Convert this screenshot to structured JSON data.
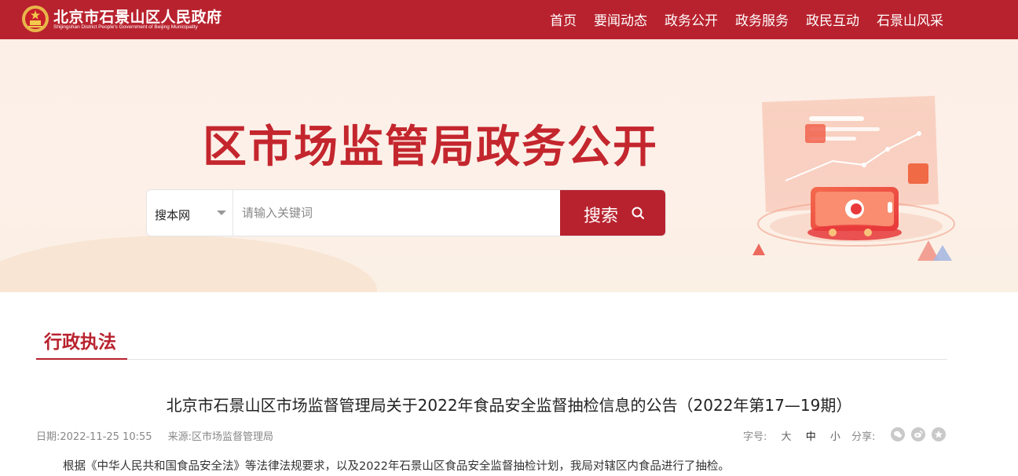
{
  "header": {
    "site_name": "北京市石景山区人民政府",
    "site_subtitle": "Shijingshan District People's Government of Beijing Municipality",
    "nav": [
      "首页",
      "要闻动态",
      "政务公开",
      "政务服务",
      "政民互动",
      "石景山风采"
    ]
  },
  "banner": {
    "title": "区市场监管局政务公开",
    "search_scope": "搜本网",
    "search_placeholder": "请输入关键词",
    "search_button": "搜索"
  },
  "section": {
    "tab": "行政执法"
  },
  "article": {
    "title": "北京市石景山区市场监督管理局关于2022年食品安全监督抽检信息的公告（2022年第17—19期）",
    "date": "日期:2022-11-25 10:55",
    "source": "来源:区市场监督管理局",
    "font_size_label": "字号:",
    "font_sizes": [
      "大",
      "中",
      "小"
    ],
    "share_label": "分享:",
    "share_icons": [
      "wechat-icon",
      "weibo-icon",
      "favorite-icon"
    ],
    "body_first_line": "根据《中华人民共和国食品安全法》等法律法规要求，以及2022年石景山区食品安全监督抽检计划，我局对辖区内食品进行了抽检。"
  },
  "colors": {
    "brand_red": "#b8222e",
    "banner_bg": "#fcefe7",
    "title_red": "#c4262e"
  }
}
